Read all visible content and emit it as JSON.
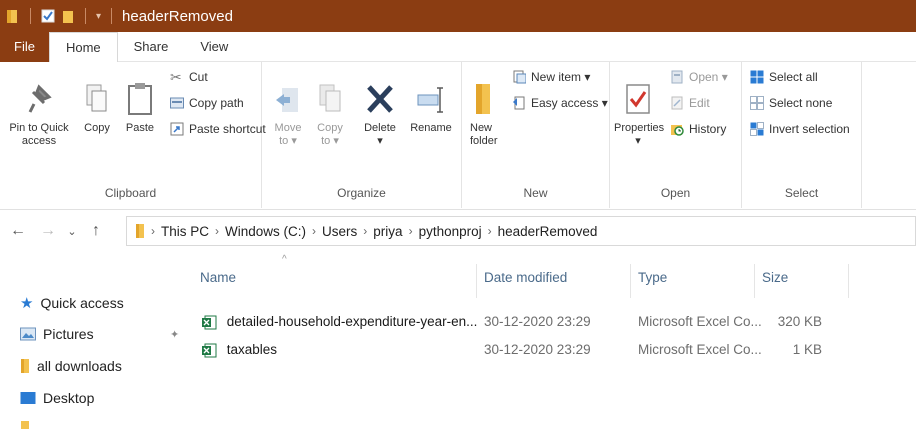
{
  "window": {
    "title": "headerRemoved"
  },
  "tabs": [
    "File",
    "Home",
    "Share",
    "View"
  ],
  "ribbon": {
    "clipboard": {
      "label": "Clipboard",
      "pin_label_1": "Pin to Quick",
      "pin_label_2": "access",
      "copy_label": "Copy",
      "paste_label": "Paste",
      "cut_label": "Cut",
      "copy_path_label": "Copy path",
      "paste_shortcut_label": "Paste shortcut"
    },
    "organize": {
      "label": "Organize",
      "move_label_1": "Move",
      "move_label_2": "to ▾",
      "copyto_label_1": "Copy",
      "copyto_label_2": "to ▾",
      "delete_label_1": "Delete",
      "delete_label_2": "▾",
      "rename_label": "Rename"
    },
    "new": {
      "label": "New",
      "new_folder_1": "New",
      "new_folder_2": "folder",
      "new_item_label": "New item ▾",
      "easy_access_label": "Easy access ▾"
    },
    "open": {
      "label": "Open",
      "properties_label_1": "Properties",
      "properties_label_2": "▾",
      "open_label": "Open ▾",
      "edit_label": "Edit",
      "history_label": "History"
    },
    "select": {
      "label": "Select",
      "select_all": "Select all",
      "select_none": "Select none",
      "invert_selection": "Invert selection"
    }
  },
  "address": {
    "crumbs": [
      "This PC",
      "Windows (C:)",
      "Users",
      "priya",
      "pythonproj",
      "headerRemoved"
    ]
  },
  "navpane": {
    "items": [
      {
        "label": "Quick access",
        "icon": "star-icon"
      },
      {
        "label": "Pictures",
        "icon": "pictures-folder-icon"
      },
      {
        "label": "all downloads",
        "icon": "folder-icon"
      },
      {
        "label": "Desktop",
        "icon": "desktop-icon"
      }
    ]
  },
  "columns": {
    "name": "Name",
    "date": "Date modified",
    "type": "Type",
    "size": "Size"
  },
  "files": [
    {
      "name": "detailed-household-expenditure-year-en...",
      "date": "30-12-2020 23:29",
      "type": "Microsoft Excel Co...",
      "size": "320 KB"
    },
    {
      "name": "taxables",
      "date": "30-12-2020 23:29",
      "type": "Microsoft Excel Co...",
      "size": "1 KB"
    }
  ],
  "colors": {
    "titlebar": "#8b3d12",
    "folder": "#e8b84a",
    "excel": "#1f7a45",
    "accent": "#2a7bd3"
  }
}
